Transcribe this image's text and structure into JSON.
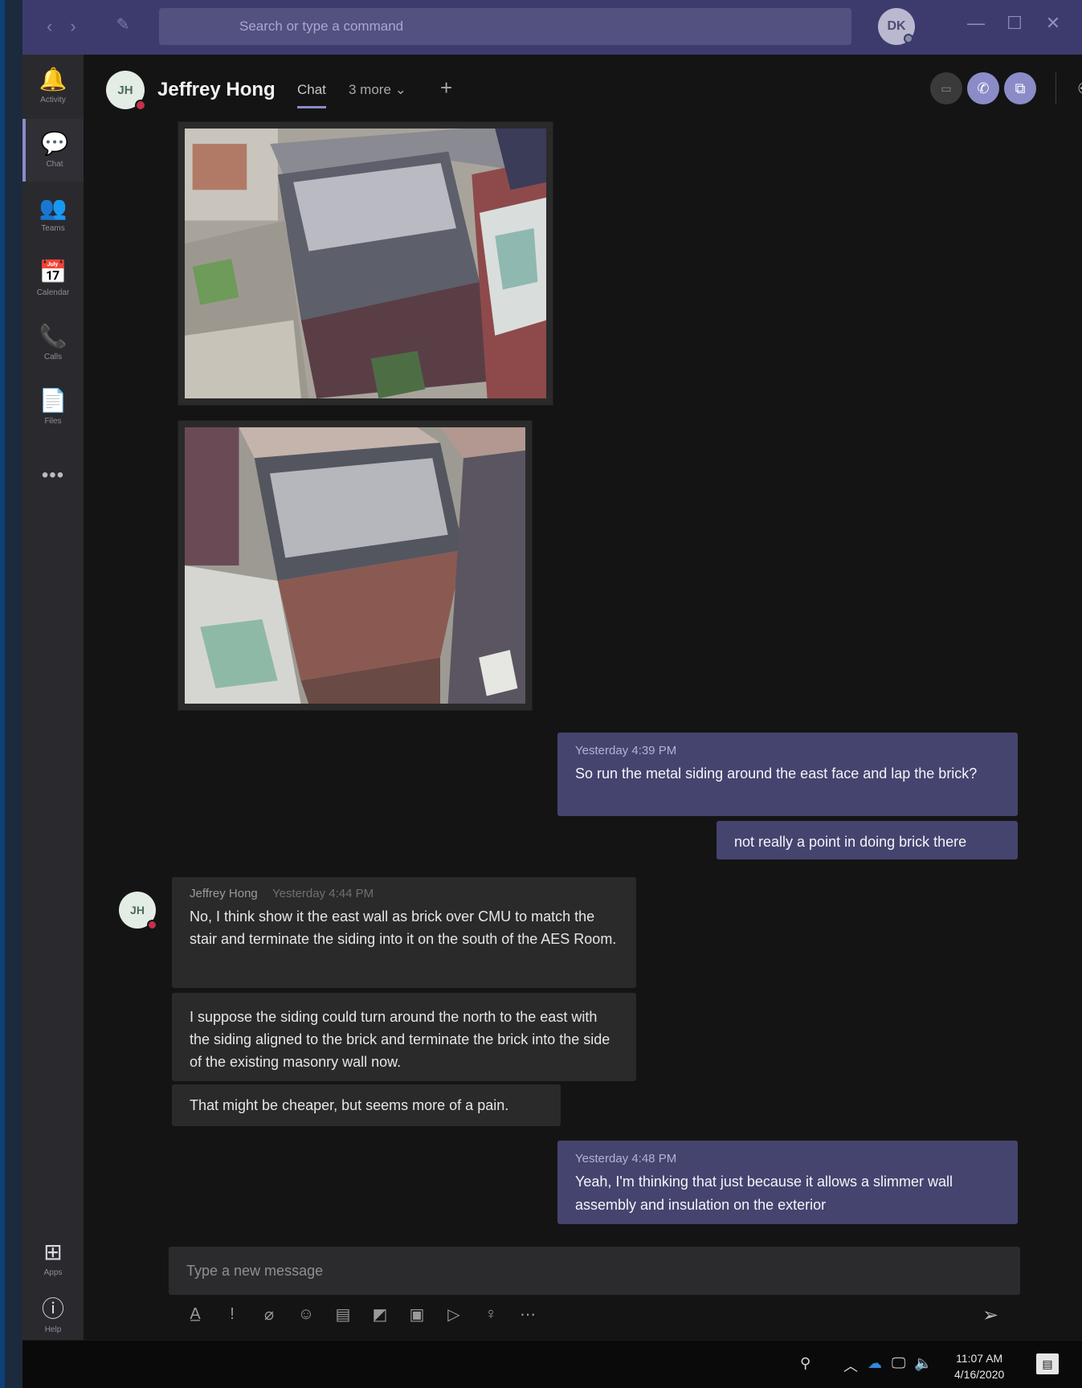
{
  "search": {
    "placeholder": "Search or type a command"
  },
  "user": {
    "initials": "DK"
  },
  "window": {
    "minimize": "—",
    "maximize": "☐",
    "close": "✕"
  },
  "rail": [
    {
      "label": "Activity",
      "glyph": "🔔"
    },
    {
      "label": "Chat",
      "glyph": "💬"
    },
    {
      "label": "Teams",
      "glyph": "👥"
    },
    {
      "label": "Calendar",
      "glyph": "📅"
    },
    {
      "label": "Calls",
      "glyph": "📞"
    },
    {
      "label": "Files",
      "glyph": "📄"
    },
    {
      "label": "Apps",
      "glyph": "⊞"
    },
    {
      "label": "Help",
      "glyph": "ⓘ"
    }
  ],
  "rail_more": "•••",
  "chat": {
    "peer_initials": "JH",
    "peer_name": "Jeffrey Hong",
    "tab_chat": "Chat",
    "tab_more": "3 more ⌄",
    "tab_add": "+"
  },
  "messages": {
    "out_1": {
      "meta": "Yesterday 4:39 PM",
      "text": "So run the metal siding around the east face and lap the brick?"
    },
    "out_2": {
      "text": "not really a point in doing brick there"
    },
    "in_1": {
      "author": "Jeffrey Hong",
      "time": "Yesterday 4:44 PM",
      "text": "No, I think show it the east wall as brick over CMU to match the stair and terminate the siding into it on the south of the AES Room."
    },
    "in_2": {
      "text": "I suppose the siding could turn around the north to the east with the siding aligned to the brick and terminate the brick into the side of the existing masonry wall now."
    },
    "in_3": {
      "text": "That might be cheaper, but seems more of a pain."
    },
    "out_3": {
      "meta": "Yesterday 4:48 PM",
      "text": "Yeah, I'm thinking that just because it allows a slimmer wall assembly and insulation on the exterior"
    }
  },
  "composer": {
    "placeholder": "Type a new message"
  },
  "taskbar": {
    "time": "11:07 AM",
    "date": "4/16/2020"
  }
}
